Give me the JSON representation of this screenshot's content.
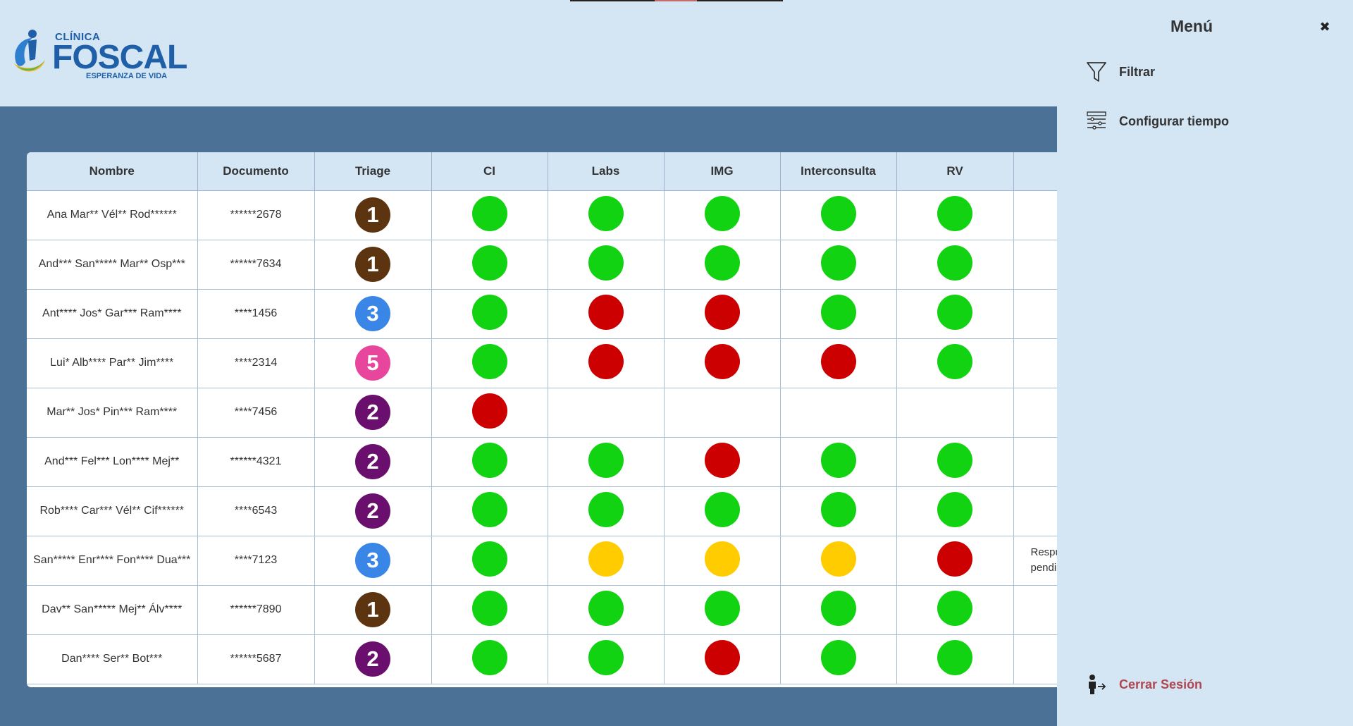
{
  "logo": {
    "clinica": "CLÍNICA",
    "name": "FOSCAL",
    "tagline": "ESPERANZA DE VIDA"
  },
  "table": {
    "columns": [
      "Nombre",
      "Documento",
      "Triage",
      "CI",
      "Labs",
      "IMG",
      "Interconsulta",
      "RV",
      ""
    ],
    "rows": [
      {
        "name": "Ana Mar** Vél** Rod******",
        "doc": "******2678",
        "triage": "1",
        "ci": "green",
        "labs": "green",
        "img": "green",
        "inter": "green",
        "rv": "green",
        "extra": ""
      },
      {
        "name": "And*** San***** Mar** Osp***",
        "doc": "******7634",
        "triage": "1",
        "ci": "green",
        "labs": "green",
        "img": "green",
        "inter": "green",
        "rv": "green",
        "extra": ""
      },
      {
        "name": "Ant**** Jos* Gar*** Ram****",
        "doc": "****1456",
        "triage": "3",
        "ci": "green",
        "labs": "red",
        "img": "red",
        "inter": "green",
        "rv": "green",
        "extra": ""
      },
      {
        "name": "Lui* Alb**** Par** Jim****",
        "doc": "****2314",
        "triage": "5",
        "ci": "green",
        "labs": "red",
        "img": "red",
        "inter": "red",
        "rv": "green",
        "extra": ""
      },
      {
        "name": "Mar** Jos* Pin*** Ram****",
        "doc": "****7456",
        "triage": "2",
        "ci": "red",
        "labs": "",
        "img": "",
        "inter": "",
        "rv": "",
        "extra": ""
      },
      {
        "name": "And*** Fel*** Lon**** Mej**",
        "doc": "******4321",
        "triage": "2",
        "ci": "green",
        "labs": "green",
        "img": "red",
        "inter": "green",
        "rv": "green",
        "extra": ""
      },
      {
        "name": "Rob**** Car*** Vél** Cif******",
        "doc": "****6543",
        "triage": "2",
        "ci": "green",
        "labs": "green",
        "img": "green",
        "inter": "green",
        "rv": "green",
        "extra": ""
      },
      {
        "name": "San***** Enr**** Fon**** Dua***",
        "doc": "****7123",
        "triage": "3",
        "ci": "green",
        "labs": "yellow",
        "img": "yellow",
        "inter": "yellow",
        "rv": "red",
        "extra": "Respuesta pendiente"
      },
      {
        "name": "Dav** San***** Mej** Álv****",
        "doc": "******7890",
        "triage": "1",
        "ci": "green",
        "labs": "green",
        "img": "green",
        "inter": "green",
        "rv": "green",
        "extra": ""
      },
      {
        "name": "Dan**** Ser** Bot***",
        "doc": "******5687",
        "triage": "2",
        "ci": "green",
        "labs": "green",
        "img": "red",
        "inter": "green",
        "rv": "green",
        "extra": ""
      }
    ]
  },
  "triage_colors": {
    "1": "#5c3510",
    "2": "#6b0f6e",
    "3": "#3a86e6",
    "5": "#e8469c"
  },
  "status_colors": {
    "green": "#12d312",
    "red": "#cc0000",
    "yellow": "#ffcc00"
  },
  "menu": {
    "title": "Menú",
    "close_icon": "close-icon",
    "items": [
      {
        "label": "Filtrar",
        "icon": "filter-icon"
      },
      {
        "label": "Configurar tiempo",
        "icon": "sliders-icon"
      }
    ],
    "logout": {
      "label": "Cerrar Sesión",
      "icon": "logout-icon"
    }
  }
}
